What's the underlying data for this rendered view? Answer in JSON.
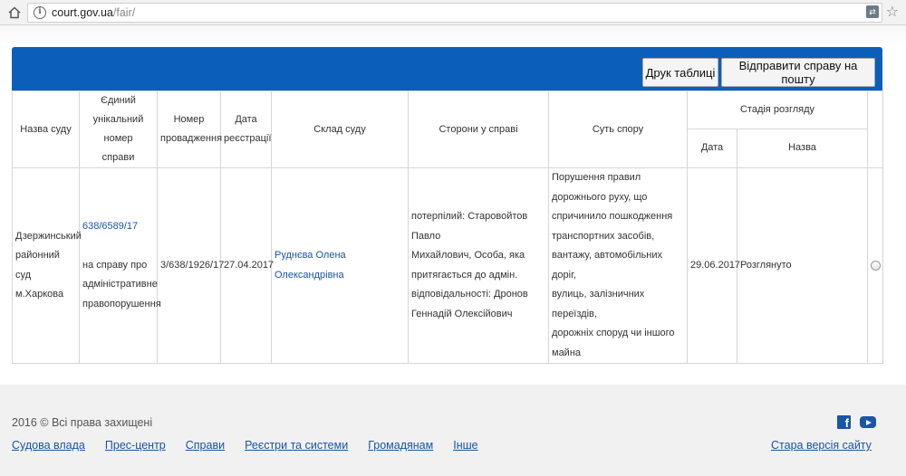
{
  "browser": {
    "url_host": "court.gov.ua",
    "url_path": "/fair/"
  },
  "toolbar": {
    "print_label": "Друк таблиці",
    "mail_label": "Відправити справу на пошту"
  },
  "table": {
    "headers": {
      "court": "Назва суду",
      "case_number": [
        "Єдиний",
        "унікальний номер",
        "справи"
      ],
      "proceeding": [
        "Номер",
        "провадження"
      ],
      "reg_date": [
        "Дата",
        "реєстрації"
      ],
      "composition": "Склад суду",
      "parties": "Сторони у справі",
      "subject": "Суть спору",
      "stage": "Стадія розгляду",
      "stage_date": "Дата",
      "stage_name": "Назва"
    },
    "row": {
      "court": [
        "Дзержинський",
        "районний суд",
        "м.Харкова"
      ],
      "case_link": "638/6589/17",
      "case_desc": [
        "на справу про",
        "адміністративне",
        "правопорушення"
      ],
      "proceeding": "3/638/1926/17",
      "reg_date": "27.04.2017",
      "judge": "Руднєва Олена Олександрівна",
      "parties": [
        "потерпілий: Старовойтов Павло",
        "Михайлович, Особа, яка",
        "притягається до адмін.",
        "відповідальності: Дронов",
        "Геннадій Олексійович"
      ],
      "subject": [
        "Порушення правил",
        "дорожнього руху, що",
        "спричинило пошкодження",
        "транспортних засобів,",
        "вантажу, автомобільних доріг,",
        "вулиць, залізничних переїздів,",
        "дорожніх споруд чи іншого",
        "майна"
      ],
      "stage_date": "29.06.2017",
      "stage_name": "Розглянуто"
    }
  },
  "footer": {
    "copyright": "2016 © Всі права захищені",
    "links": [
      "Судова влада",
      "Прес-центр",
      "Справи",
      "Реєстри та системи",
      "Громадянам",
      "Інше"
    ],
    "old_version": "Стара версія сайту",
    "facebook_glyph": "f"
  }
}
